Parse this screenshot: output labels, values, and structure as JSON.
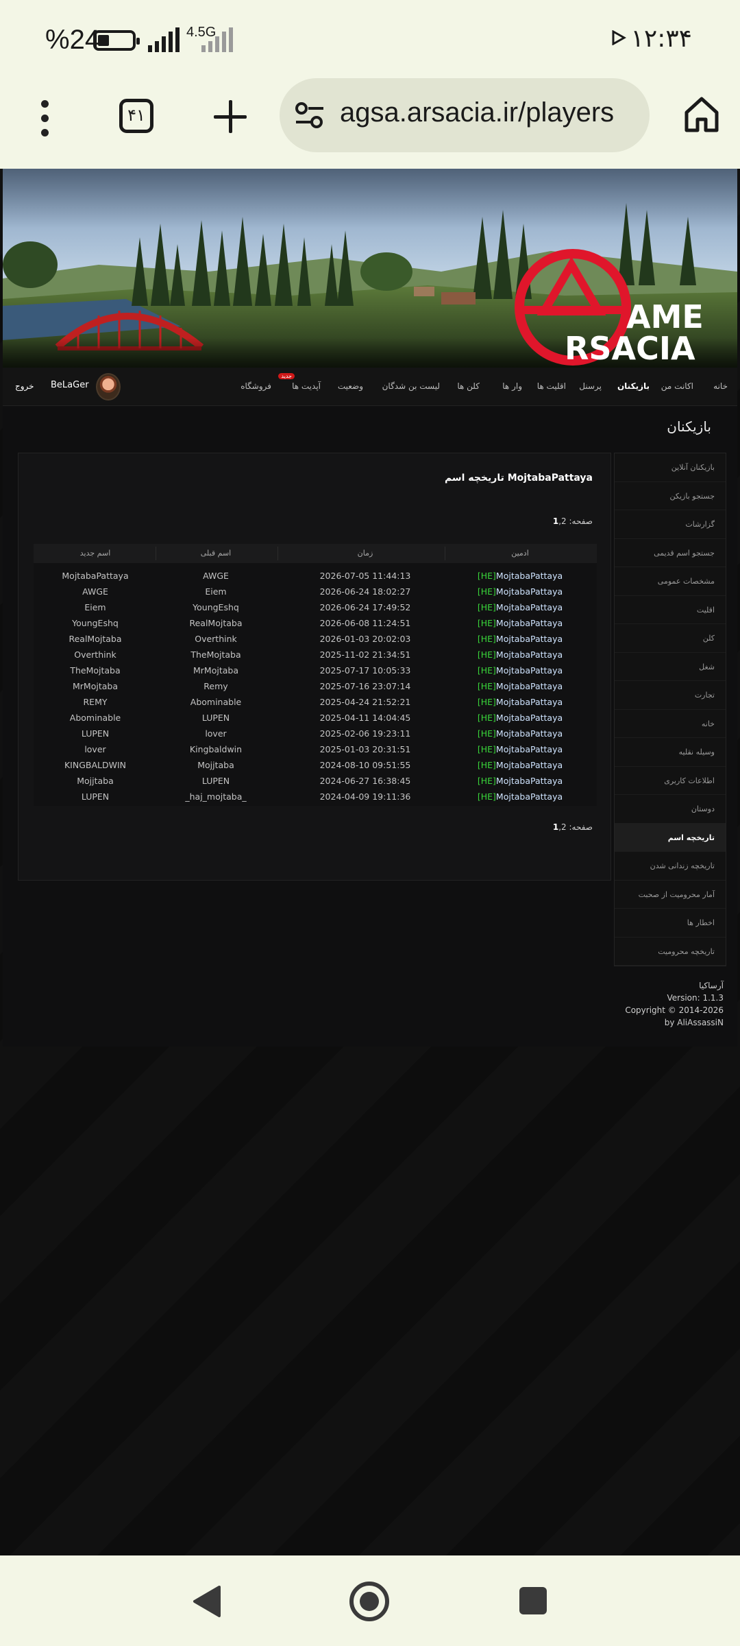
{
  "status": {
    "time": "۱۲:۳۴",
    "battery_percent": "%24",
    "network": "4.5G"
  },
  "browser": {
    "url": "agsa.arsacia.ir/players",
    "tab_count": "۴۱"
  },
  "nav": {
    "items": [
      {
        "label": "خانه",
        "active": false
      },
      {
        "label": "اکانت من",
        "active": false
      },
      {
        "label": "بازیکنان",
        "active": true
      },
      {
        "label": "پرسنل",
        "active": false
      },
      {
        "label": "اقلیت ها",
        "active": false
      },
      {
        "label": "وار ها",
        "active": false
      },
      {
        "label": "کلن ها",
        "active": false
      },
      {
        "label": "لیست بن شدگان",
        "active": false
      },
      {
        "label": "وضعیت",
        "active": false
      },
      {
        "label": "آپدیت ها",
        "active": false,
        "badge": "جدید"
      },
      {
        "label": "فروشگاه",
        "active": false
      }
    ],
    "username": "BeLaGer",
    "logout": "خروج"
  },
  "page_heading": "بازیکنان",
  "sidebar": {
    "items": [
      {
        "label": "بازیکنان آنلاین",
        "active": false
      },
      {
        "label": "جستجو بازیکن",
        "active": false
      },
      {
        "label": "گزارشات",
        "active": false
      },
      {
        "label": "جستجو اسم قدیمی",
        "active": false
      },
      {
        "label": "مشخصات عمومی",
        "active": false
      },
      {
        "label": "اقلیت",
        "active": false
      },
      {
        "label": "کلن",
        "active": false
      },
      {
        "label": "شغل",
        "active": false
      },
      {
        "label": "تجارت",
        "active": false
      },
      {
        "label": "خانه",
        "active": false
      },
      {
        "label": "وسیله نقلیه",
        "active": false
      },
      {
        "label": "اطلاعات کاربری",
        "active": false
      },
      {
        "label": "دوستان",
        "active": false
      },
      {
        "label": "تاریخچه اسم",
        "active": true
      },
      {
        "label": "تاریخچه زندانی شدن",
        "active": false
      },
      {
        "label": "آمار محرومیت از صحبت",
        "active": false
      },
      {
        "label": "اخطار ها",
        "active": false
      },
      {
        "label": "تاریخچه محرومیت",
        "active": false
      }
    ]
  },
  "panel": {
    "title": "تاریخچه اسم MojtabaPattaya",
    "page_label": "صفحه:",
    "pages_current": "1",
    "pages_other": "2",
    "columns": {
      "admin": "ادمین",
      "time": "زمان",
      "old_name": "اسم قبلی",
      "new_name": "اسم جدید"
    },
    "rows": [
      {
        "new": "MojtabaPattaya",
        "old": "AWGE",
        "time": "2026-07-05 11:44:13",
        "admin_tag": "[HE]",
        "admin": "MojtabaPattaya"
      },
      {
        "new": "AWGE",
        "old": "Eiem",
        "time": "2026-06-24 18:02:27",
        "admin_tag": "[HE]",
        "admin": "MojtabaPattaya"
      },
      {
        "new": "Eiem",
        "old": "YoungEshq",
        "time": "2026-06-24 17:49:52",
        "admin_tag": "[HE]",
        "admin": "MojtabaPattaya"
      },
      {
        "new": "YoungEshq",
        "old": "RealMojtaba",
        "time": "2026-06-08 11:24:51",
        "admin_tag": "[HE]",
        "admin": "MojtabaPattaya"
      },
      {
        "new": "RealMojtaba",
        "old": "Overthink",
        "time": "2026-01-03 20:02:03",
        "admin_tag": "[HE]",
        "admin": "MojtabaPattaya"
      },
      {
        "new": "Overthink",
        "old": "TheMojtaba",
        "time": "2025-11-02 21:34:51",
        "admin_tag": "[HE]",
        "admin": "MojtabaPattaya"
      },
      {
        "new": "TheMojtaba",
        "old": "MrMojtaba",
        "time": "2025-07-17 10:05:33",
        "admin_tag": "[HE]",
        "admin": "MojtabaPattaya"
      },
      {
        "new": "MrMojtaba",
        "old": "Remy",
        "time": "2025-07-16 23:07:14",
        "admin_tag": "[HE]",
        "admin": "MojtabaPattaya"
      },
      {
        "new": "REMY",
        "old": "Abominable",
        "time": "2025-04-24 21:52:21",
        "admin_tag": "[HE]",
        "admin": "MojtabaPattaya"
      },
      {
        "new": "Abominable",
        "old": "LUPEN",
        "time": "2025-04-11 14:04:45",
        "admin_tag": "[HE]",
        "admin": "MojtabaPattaya"
      },
      {
        "new": "LUPEN",
        "old": "lover",
        "time": "2025-02-06 19:23:11",
        "admin_tag": "[HE]",
        "admin": "MojtabaPattaya"
      },
      {
        "new": "lover",
        "old": "Kingbaldwin",
        "time": "2025-01-03 20:31:51",
        "admin_tag": "[HE]",
        "admin": "MojtabaPattaya"
      },
      {
        "new": "KINGBALDWIN",
        "old": "Mojjtaba",
        "time": "2024-08-10 09:51:55",
        "admin_tag": "[HE]",
        "admin": "MojtabaPattaya"
      },
      {
        "new": "Mojjtaba",
        "old": "LUPEN",
        "time": "2024-06-27 16:38:45",
        "admin_tag": "[HE]",
        "admin": "MojtabaPattaya"
      },
      {
        "new": "LUPEN",
        "old": "_haj_mojtaba_",
        "time": "2024-04-09 19:11:36",
        "admin_tag": "[HE]",
        "admin": "MojtabaPattaya"
      }
    ]
  },
  "footer": {
    "line1": "آرساکیا",
    "line2": "Version: 1.1.3",
    "line3": "Copyright © 2014-2026",
    "line4": "by AliAssassiN"
  },
  "banner": {
    "logo_line1": "AME",
    "logo_line2": "RSACIA"
  },
  "colors": {
    "admin_tag": "#39d63a",
    "logo_red": "#e0162b",
    "badge": "#d01818"
  }
}
